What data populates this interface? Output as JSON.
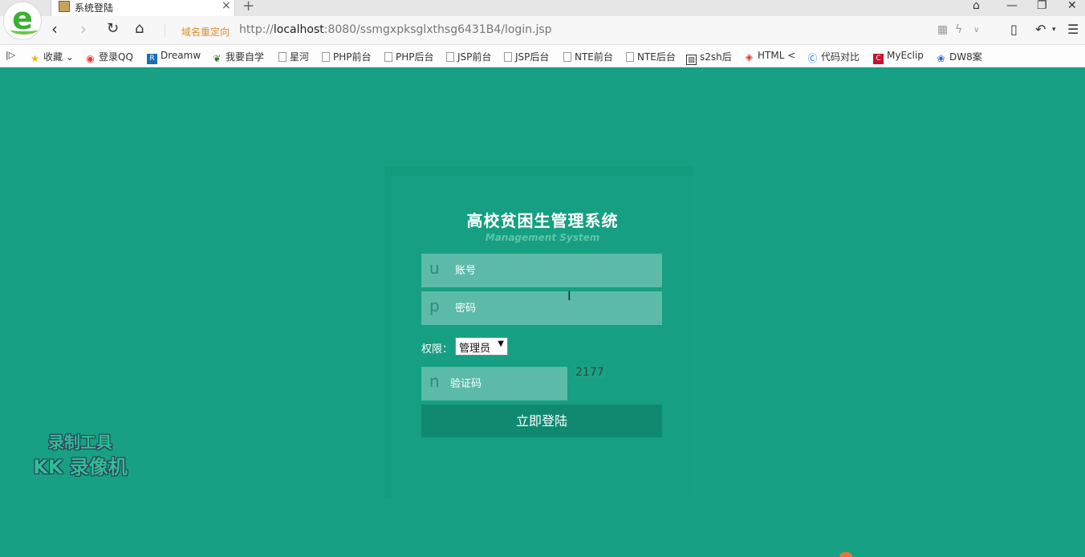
{
  "browser": {
    "tab_title": "系统登陆",
    "tab_close": "×",
    "new_tab": "+",
    "redirect_label": "域名重定向",
    "url_prefix": "http://",
    "url_host": "localhost",
    "url_rest": ":8080/ssmgxpksglxthsg6431B4/login.jsp"
  },
  "bookmarks": [
    {
      "label": "收藏",
      "icon": "star-icon"
    },
    {
      "label": "登录QQ",
      "icon": "qq-icon"
    },
    {
      "label": "Dreamw",
      "icon": "dreamweaver-icon"
    },
    {
      "label": "我要自学",
      "icon": "leaf-icon"
    },
    {
      "label": "星河",
      "icon": "page-icon"
    },
    {
      "label": "PHP前台",
      "icon": "page-icon"
    },
    {
      "label": "PHP后台",
      "icon": "page-icon"
    },
    {
      "label": "JSP前台",
      "icon": "page-icon"
    },
    {
      "label": "JSP后台",
      "icon": "page-icon"
    },
    {
      "label": "NTE前台",
      "icon": "page-icon"
    },
    {
      "label": "NTE后台",
      "icon": "page-icon"
    },
    {
      "label": "s2sh后",
      "icon": "image-icon"
    },
    {
      "label": "HTML <",
      "icon": "html-icon"
    },
    {
      "label": "代码对比",
      "icon": "compare-icon"
    },
    {
      "label": "MyEclip",
      "icon": "myeclipse-icon"
    },
    {
      "label": "DW8案",
      "icon": "paw-icon"
    }
  ],
  "login": {
    "title": "高校贫困生管理系统",
    "subtitle": "Management System",
    "username_letter": "u",
    "username_placeholder": "账号",
    "password_letter": "p",
    "password_placeholder": "密码",
    "role_label": "权限：",
    "role_selected": "管理员",
    "captcha_letter": "n",
    "captcha_placeholder": "验证码",
    "captcha_code": "2177",
    "submit_label": "立即登陆"
  },
  "watermark": {
    "line1": "录制工具",
    "line2": "KK 录像机"
  },
  "colors": {
    "background": "#17a083",
    "field": "#5cbaa8",
    "button": "#0f8a70"
  }
}
